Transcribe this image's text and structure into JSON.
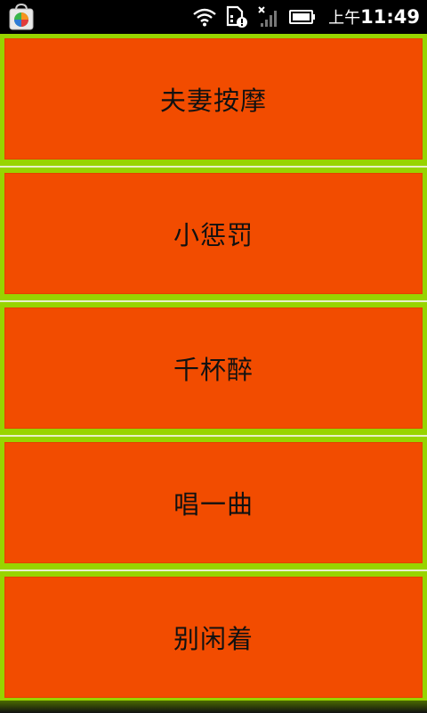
{
  "status_bar": {
    "ampm": "上午",
    "time": "11:49",
    "icons": [
      "app-store-icon",
      "wifi-icon",
      "sd-card-warning-icon",
      "no-signal-icon",
      "battery-icon"
    ]
  },
  "menu": {
    "items": [
      {
        "label": "夫妻按摩"
      },
      {
        "label": "小惩罚"
      },
      {
        "label": "千杯醉"
      },
      {
        "label": "唱一曲"
      },
      {
        "label": "别闲着"
      }
    ]
  },
  "colors": {
    "item_bg": "#f24c00",
    "frame": "#98d400",
    "status_bar": "#000000"
  }
}
